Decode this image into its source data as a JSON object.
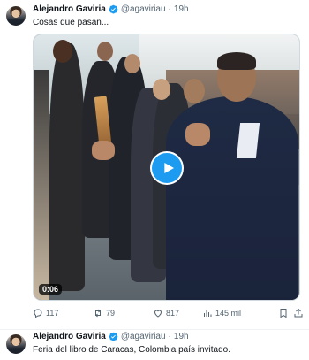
{
  "tweets": [
    {
      "author": {
        "name": "Alejandro Gaviria",
        "handle": "@agaviriau",
        "verified": true
      },
      "separator": "·",
      "time": "19h",
      "text": "Cosas que pasan...",
      "media": {
        "type": "video",
        "duration": "0:06"
      },
      "metrics": {
        "replies": "117",
        "retweets": "79",
        "likes": "817",
        "views": "145 mil"
      }
    },
    {
      "author": {
        "name": "Alejandro Gaviria",
        "handle": "@agaviriau",
        "verified": true
      },
      "separator": "·",
      "time": "19h",
      "text": "Feria del libro de Caracas, Colombia país invitado."
    }
  ],
  "colors": {
    "accent": "#1d9bf0",
    "muted": "#536471",
    "text": "#0f1419"
  },
  "icons": [
    "verified-badge-icon",
    "play-icon",
    "reply-icon",
    "retweet-icon",
    "like-icon",
    "views-icon",
    "bookmark-icon",
    "share-icon"
  ]
}
